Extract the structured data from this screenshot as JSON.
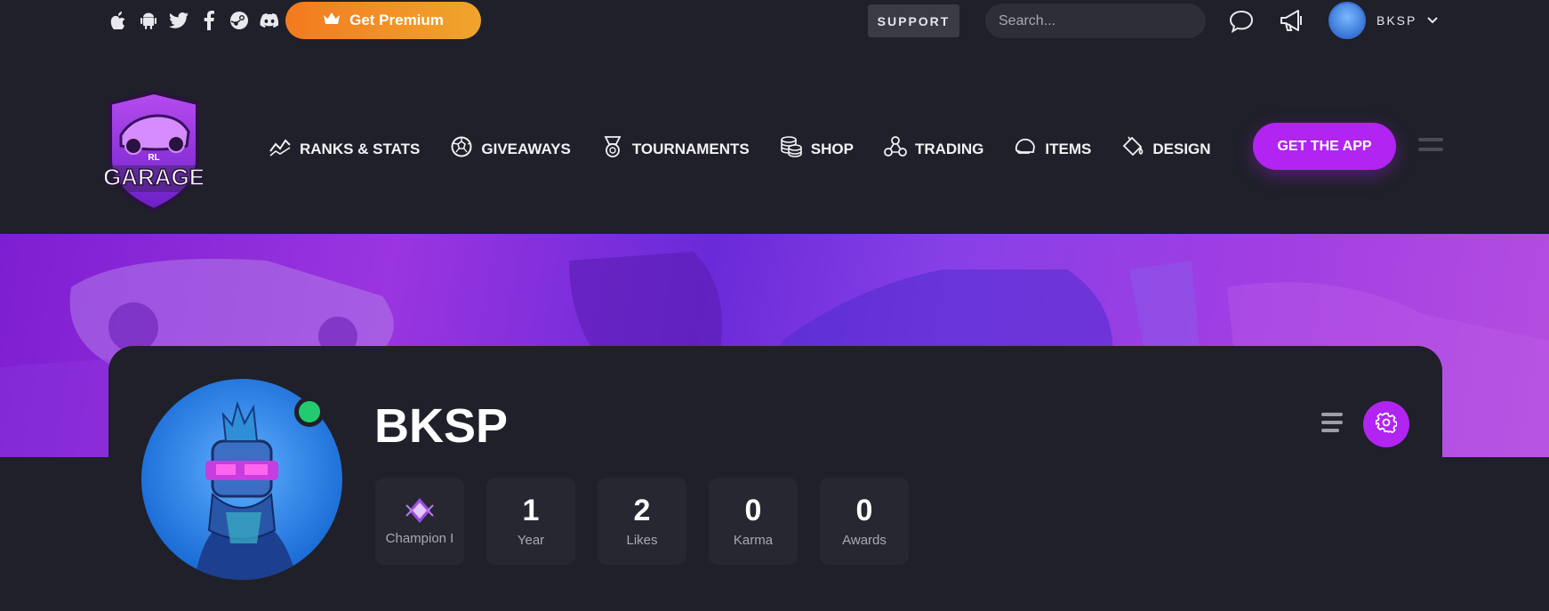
{
  "topbar": {
    "social_icons": [
      "apple-icon",
      "android-icon",
      "twitter-icon",
      "facebook-icon",
      "steam-icon",
      "discord-icon"
    ],
    "premium_label": "Get Premium",
    "support_label": "SUPPORT",
    "search_placeholder": "Search...",
    "username": "BKSP"
  },
  "nav": {
    "items": [
      {
        "label": "RANKS & STATS",
        "icon": "stats-icon"
      },
      {
        "label": "GIVEAWAYS",
        "icon": "ball-icon"
      },
      {
        "label": "TOURNAMENTS",
        "icon": "medal-icon"
      },
      {
        "label": "SHOP",
        "icon": "coins-icon"
      },
      {
        "label": "TRADING",
        "icon": "trading-icon"
      },
      {
        "label": "ITEMS",
        "icon": "helmet-icon"
      },
      {
        "label": "DESIGN",
        "icon": "paint-bucket-icon"
      }
    ],
    "get_app_label": "GET THE APP"
  },
  "logo": {
    "top_text": "RL",
    "main_text": "GARAGE"
  },
  "profile": {
    "name": "BKSP",
    "stats": [
      {
        "value": "",
        "label": "Champion I",
        "icon": "rank-champion-icon"
      },
      {
        "value": "1",
        "label": "Year"
      },
      {
        "value": "2",
        "label": "Likes"
      },
      {
        "value": "0",
        "label": "Karma"
      },
      {
        "value": "0",
        "label": "Awards"
      }
    ]
  },
  "colors": {
    "accent": "#b224f2",
    "premium_start": "#f37a1f",
    "premium_end": "#f0a52c",
    "online": "#22cc6e",
    "background": "#1f2029"
  }
}
